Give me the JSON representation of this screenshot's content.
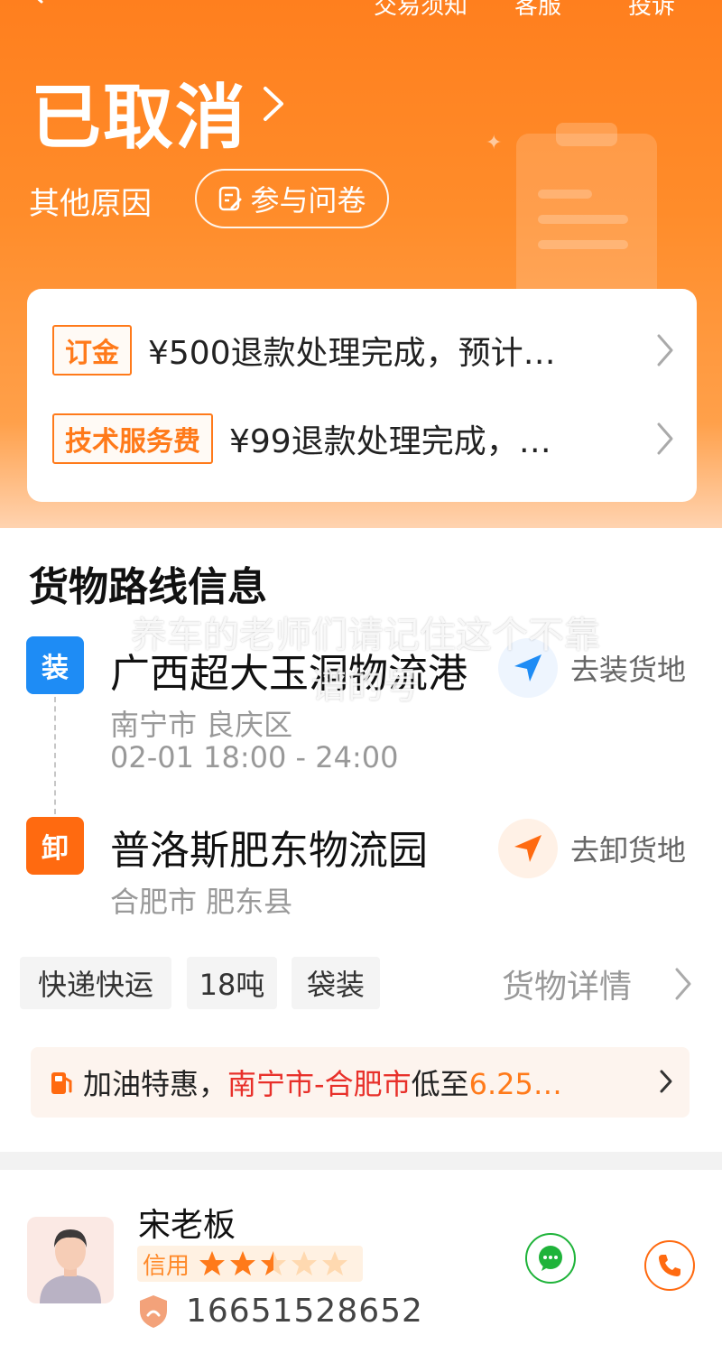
{
  "topbar": {
    "trade_notice": "交易须知",
    "customer_service": "客服",
    "complaint": "投诉"
  },
  "status": {
    "title": "已取消",
    "reason": "其他原因",
    "survey_label": "参与问卷"
  },
  "refunds": [
    {
      "tag": "订金",
      "text": "¥500退款处理完成，预计…"
    },
    {
      "tag": "技术服务费",
      "text": "¥99退款处理完成，…"
    }
  ],
  "route": {
    "section_title": "货物路线信息",
    "load": {
      "badge": "装",
      "name": "广西超大玉洞物流港",
      "area": "南宁市 良庆区",
      "time": "02-01 18:00 - 24:00",
      "nav_label": "去装货地"
    },
    "unload": {
      "badge": "卸",
      "name": "普洛斯肥东物流园",
      "area": "合肥市 肥东县",
      "nav_label": "去卸货地"
    }
  },
  "cargo": {
    "tags": [
      "快递快运",
      "18吨",
      "袋装"
    ],
    "detail_label": "货物详情"
  },
  "fuel": {
    "prefix": "加油特惠，",
    "route": "南宁市-合肥市",
    "middle": "低至",
    "price": "6.25…"
  },
  "driver": {
    "name": "宋老板",
    "credit_label": "信用",
    "rating": 2.5,
    "rating_max": 5,
    "phone": "16651528652"
  },
  "watermark": {
    "line1": "养车的老师们请记住这个不靠",
    "line2": "谱的号"
  },
  "colors": {
    "brand_orange": "#ff7f1e",
    "load_blue": "#1e8cf5",
    "unload_orange": "#ff6a10",
    "route_red": "#e8302a",
    "wechat_green": "#1fb33a"
  }
}
